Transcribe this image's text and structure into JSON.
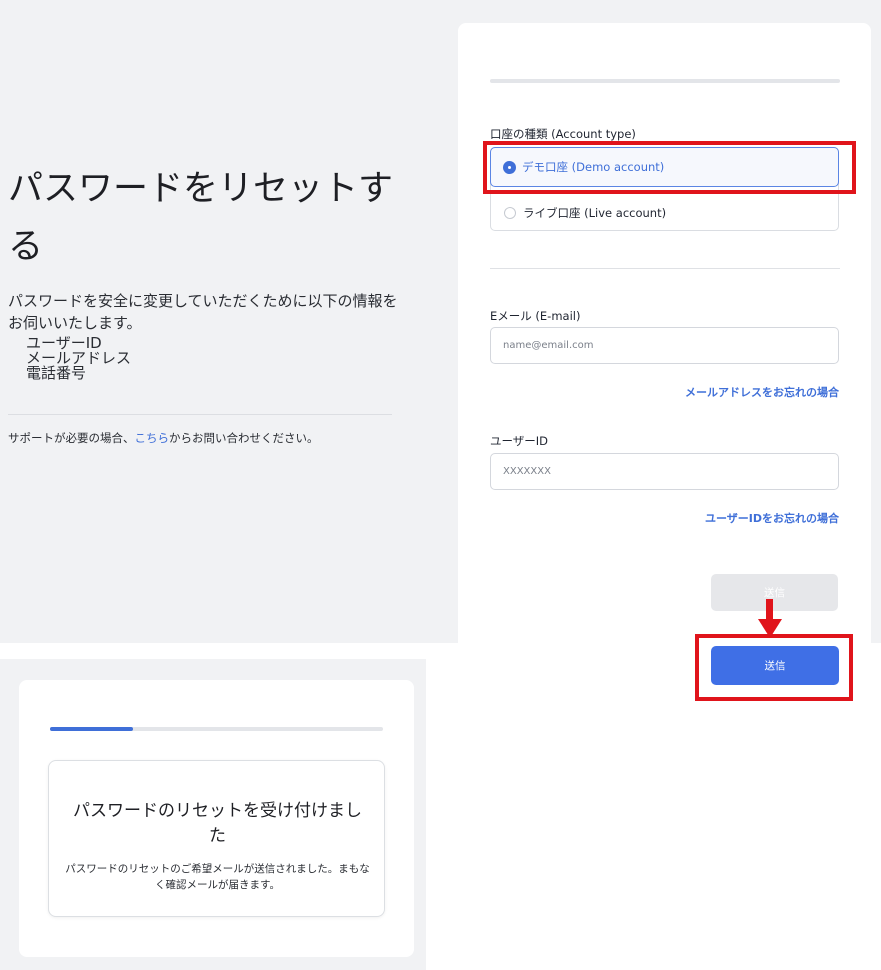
{
  "left": {
    "title": "パスワードをリセットする",
    "intro": "パスワードを安全に変更していただくために以下の情報をお伺いいたします。",
    "requirements": [
      "ユーザーID",
      "メールアドレス",
      "電話番号"
    ],
    "support_prefix": "サポートが必要の場合、",
    "support_link": "こちら",
    "support_suffix": "からお問い合わせください。"
  },
  "form": {
    "account_type_label": "口座の種類 (Account type)",
    "account_options": [
      {
        "label": "デモ口座 (Demo account)",
        "selected": true
      },
      {
        "label": "ライブ口座 (Live account)",
        "selected": false
      }
    ],
    "email_label": "Eメール (E-mail)",
    "email_placeholder": "name@email.com",
    "email_value": "",
    "forgot_email": "メールアドレスをお忘れの場合",
    "userid_label": "ユーザーID",
    "userid_placeholder": "XXXXXXX",
    "userid_value": "",
    "forgot_userid": "ユーザーIDをお忘れの場合",
    "submit_label": "送信",
    "submit_active_label": "送信"
  },
  "confirmation": {
    "progress_fraction": 0.25,
    "title": "パスワードのリセットを受け付けました",
    "body": "パスワードのリセットのご希望メールが送信されました。まもなく確認メールが届きます。"
  },
  "colors": {
    "accent": "#3f6fd8",
    "button": "#3f6fe6",
    "highlight": "#e0141b",
    "panel_bg": "#f1f2f4"
  }
}
